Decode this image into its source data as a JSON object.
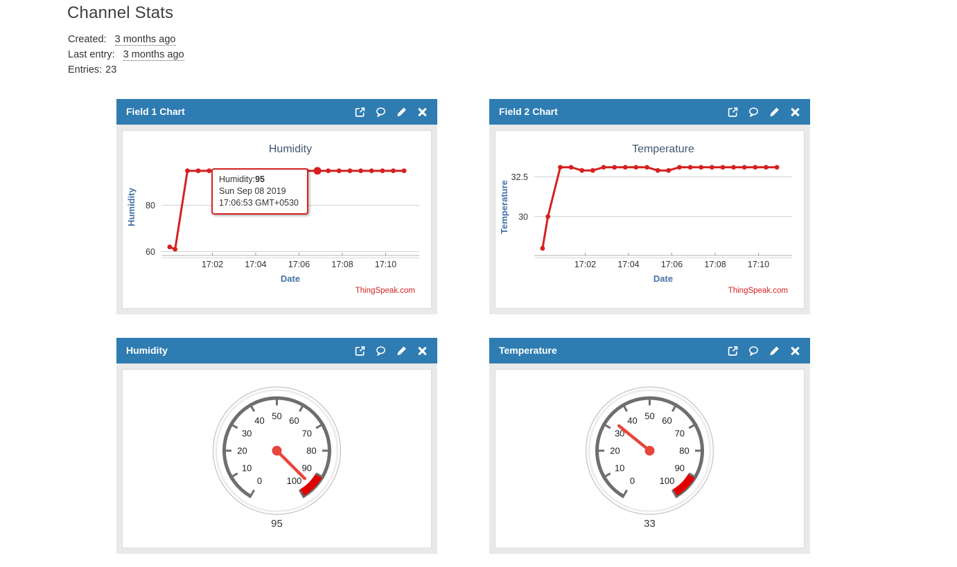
{
  "page": {
    "title": "Channel Stats",
    "meta": [
      {
        "label": "Created:",
        "value": "3 months ago"
      },
      {
        "label": "Last entry:",
        "value": "3 months ago"
      },
      {
        "label": "Entries:",
        "value": "23"
      }
    ]
  },
  "colors": {
    "panel_header_blue": "#2e7cb1",
    "series_red": "#d62020",
    "axis_label_blue": "#4572a7",
    "chart_title": "#3e576f",
    "gauge_ring_gray": "#6e6e6e",
    "gauge_red_zone": "#e00000",
    "gauge_needle_red": "#e8453c",
    "watermark_red": "#d62020"
  },
  "panels": [
    {
      "title": "Field 1 Chart",
      "icons": [
        "external-link-icon",
        "comment-icon",
        "pencil-icon",
        "close-icon"
      ]
    },
    {
      "title": "Field 2 Chart",
      "icons": [
        "external-link-icon",
        "comment-icon",
        "pencil-icon",
        "close-icon"
      ]
    },
    {
      "title": "Humidity",
      "icons": [
        "external-link-icon",
        "comment-icon",
        "pencil-icon",
        "close-icon"
      ]
    },
    {
      "title": "Temperature",
      "icons": [
        "external-link-icon",
        "comment-icon",
        "pencil-icon",
        "close-icon"
      ]
    }
  ],
  "chart_data": [
    {
      "type": "line",
      "title": "Humidity",
      "xlabel": "Date",
      "ylabel": "Humidity",
      "watermark": "ThingSpeak.com",
      "x_minutes_after_1700": [
        0.03,
        0.28,
        0.85,
        1.35,
        1.85,
        2.35,
        2.85,
        3.35,
        3.85,
        4.35,
        4.85,
        5.35,
        5.85,
        6.35,
        6.85,
        7.35,
        7.85,
        8.35,
        8.85,
        9.35,
        9.85,
        10.35,
        10.85
      ],
      "values": [
        62,
        61,
        95,
        95,
        95,
        95,
        95,
        95,
        95,
        95,
        95,
        95,
        95,
        95,
        95,
        95,
        95,
        95,
        95,
        95,
        95,
        95,
        95
      ],
      "xlim": [
        -0.35,
        11.55
      ],
      "ylim": [
        58.3,
        100.3
      ],
      "xticks": [
        {
          "t": 2,
          "label": "17:02"
        },
        {
          "t": 4,
          "label": "17:04"
        },
        {
          "t": 6,
          "label": "17:06"
        },
        {
          "t": 8,
          "label": "17:08"
        },
        {
          "t": 10,
          "label": "17:10"
        }
      ],
      "yticks": [
        {
          "v": 60,
          "label": "60"
        },
        {
          "v": 80,
          "label": "80"
        }
      ],
      "highlight_index": 14,
      "tooltip": {
        "label": "Humidity:",
        "value": "95",
        "date": "Sun Sep 08 2019",
        "time": "17:06:53 GMT+0530"
      }
    },
    {
      "type": "line",
      "title": "Temperature",
      "xlabel": "Date",
      "ylabel": "Temperature",
      "watermark": "ThingSpeak.com",
      "x_minutes_after_1700": [
        0.03,
        0.28,
        0.85,
        1.35,
        1.85,
        2.35,
        2.85,
        3.35,
        3.85,
        4.35,
        4.85,
        5.35,
        5.85,
        6.35,
        6.85,
        7.35,
        7.85,
        8.35,
        8.85,
        9.35,
        9.85,
        10.35,
        10.85
      ],
      "values": [
        28,
        30,
        33.1,
        33.1,
        32.9,
        32.9,
        33.1,
        33.1,
        33.1,
        33.1,
        33.1,
        32.9,
        32.9,
        33.1,
        33.1,
        33.1,
        33.1,
        33.1,
        33.1,
        33.1,
        33.1,
        33.1,
        33.1
      ],
      "xlim": [
        -0.35,
        11.55
      ],
      "ylim": [
        27.55,
        33.65
      ],
      "xticks": [
        {
          "t": 2,
          "label": "17:02"
        },
        {
          "t": 4,
          "label": "17:04"
        },
        {
          "t": 6,
          "label": "17:06"
        },
        {
          "t": 8,
          "label": "17:08"
        },
        {
          "t": 10,
          "label": "17:10"
        }
      ],
      "yticks": [
        {
          "v": 30,
          "label": "30"
        },
        {
          "v": 32.5,
          "label": "32.5"
        }
      ],
      "highlight_index": null
    },
    {
      "type": "gauge",
      "title": "Humidity",
      "value": 95,
      "display_value": "95",
      "min": 0,
      "max": 100,
      "tick_step": 10,
      "red_from": 90,
      "red_to": 100
    },
    {
      "type": "gauge",
      "title": "Temperature",
      "value": 33,
      "display_value": "33",
      "min": 0,
      "max": 100,
      "tick_step": 10,
      "red_from": 90,
      "red_to": 100
    }
  ]
}
